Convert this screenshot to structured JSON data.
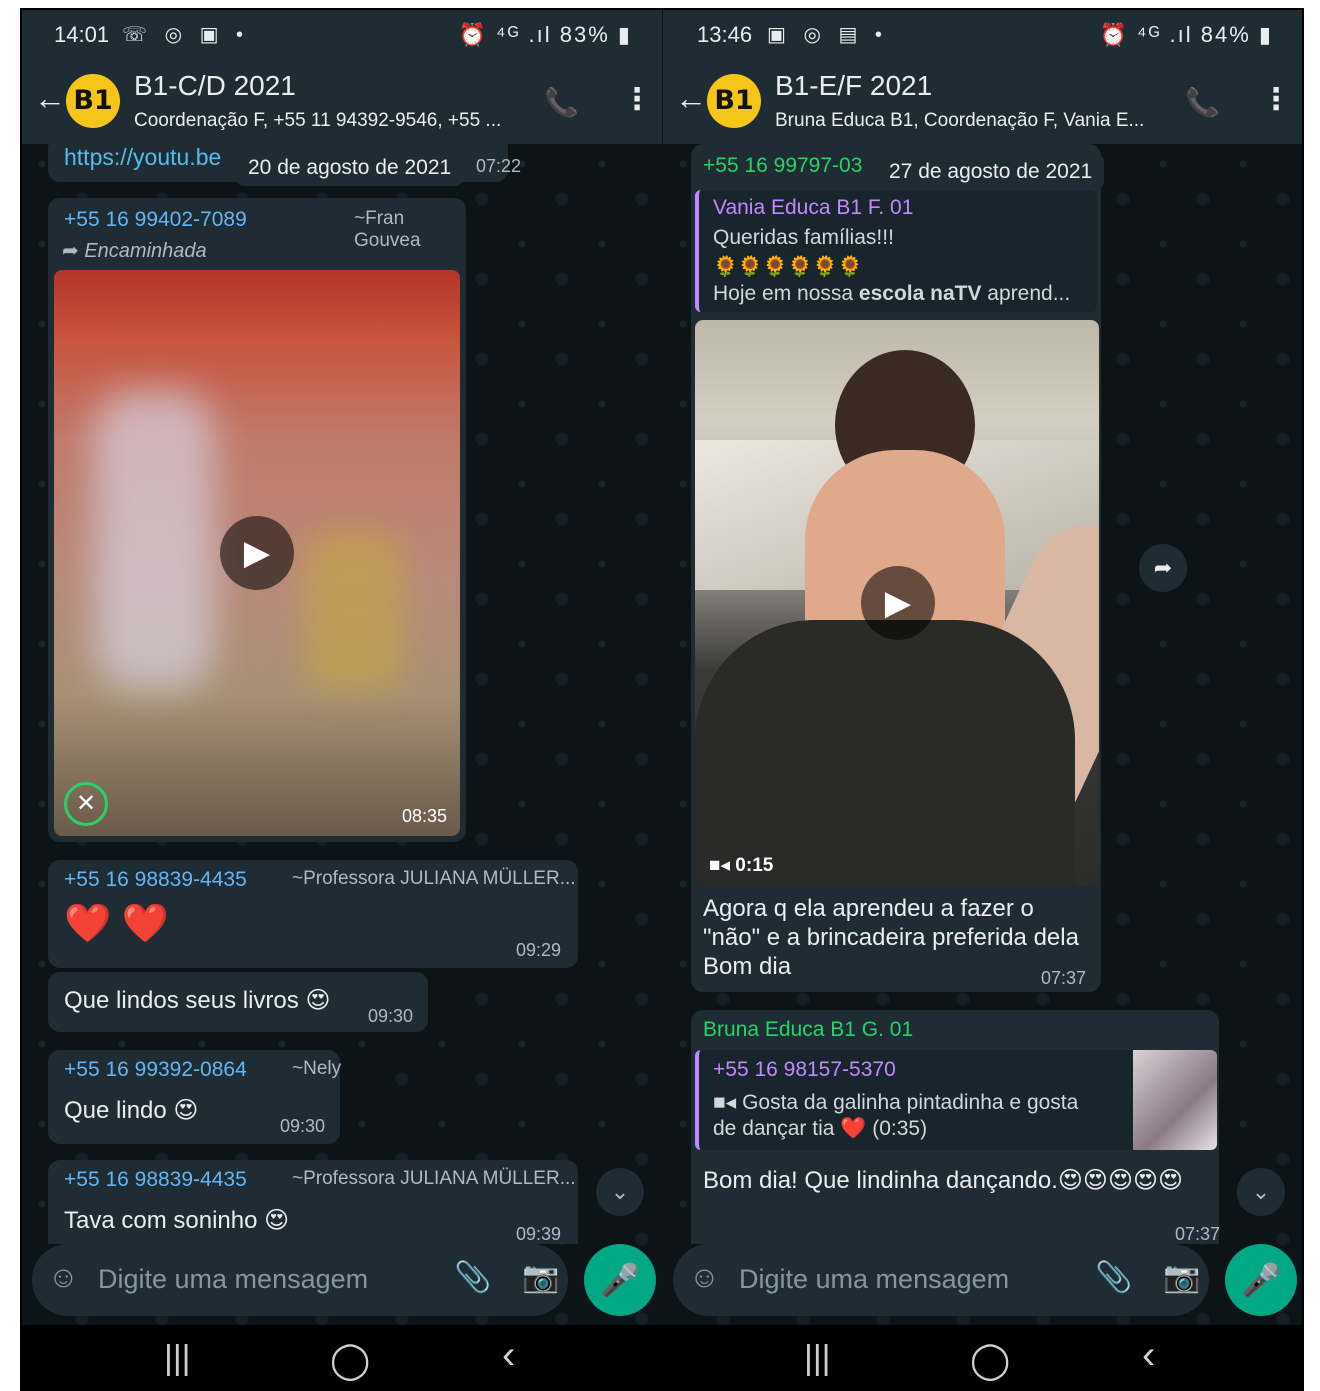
{
  "left": {
    "status": {
      "time": "14:01",
      "icons": "☏ ◎ ▣ •",
      "right": "⏰ ⁴ᴳ .ıl 83% ▮"
    },
    "header": {
      "avatar": "B1",
      "title": "B1-C/D 2021",
      "subtitle": "Coordenação F, +55 11 94392-9546, +55 ..."
    },
    "top_link": "https://youtu.be",
    "top_time": "07:22",
    "date": "20 de agosto de 2021",
    "m1": {
      "sender": "+55 16 99402-7089",
      "alias": "~Fran Gouvea",
      "forwarded": "Encaminhada",
      "duration": "08:35"
    },
    "m2": {
      "sender": "+55 16 98839-4435",
      "alias": "~Professora JULIANA MÜLLER...",
      "text": "❤️ ❤️",
      "time": "09:29"
    },
    "m3": {
      "text": "Que lindos seus livros 😍",
      "time": "09:30"
    },
    "m4": {
      "sender": "+55 16 99392-0864",
      "alias": "~Nely",
      "text": "Que lindo 😍",
      "time": "09:30"
    },
    "m5": {
      "sender": "+55 16 98839-4435",
      "alias": "~Professora JULIANA MÜLLER...",
      "text": "Tava com soninho 😍",
      "time": "09:39"
    },
    "input_placeholder": "Digite uma mensagem"
  },
  "right": {
    "status": {
      "time": "13:46",
      "icons": "▣ ◎ ▤ •",
      "right": "⏰ ⁴ᴳ .ıl 84% ▮"
    },
    "header": {
      "avatar": "B1",
      "title": "B1-E/F 2021",
      "subtitle": "Bruna Educa B1, Coordenação F, Vania E..."
    },
    "top_sender": "+55 16 99797-03",
    "date": "27 de agosto de 2021",
    "m1": {
      "quote_sender": "Vania Educa B1 F. 01",
      "quote_line1": "Queridas famílias!!!",
      "quote_line2": "🌻🌻🌻🌻🌻🌻",
      "quote_line3_a": "Hoje em nossa ",
      "quote_line3_b": "escola naTV",
      "quote_line3_c": " aprend...",
      "video_duration": "0:15",
      "text": "Agora q ela aprendeu a fazer o \"não\" e a brincadeira preferida dela Bom dia",
      "time": "07:37"
    },
    "m2": {
      "sender": "Bruna Educa B1 G. 01",
      "quote_sender": "+55 16 98157-5370",
      "quote_text": "Gosta da galinha pintadinha e gosta de dançar tia ❤️ (0:35)",
      "text": "Bom dia! Que lindinha dançando.😍😍😍😍😍",
      "time": "07:37"
    },
    "input_placeholder": "Digite uma mensagem"
  },
  "nav": {
    "recent": "|||",
    "home": "◯",
    "back": "‹"
  }
}
